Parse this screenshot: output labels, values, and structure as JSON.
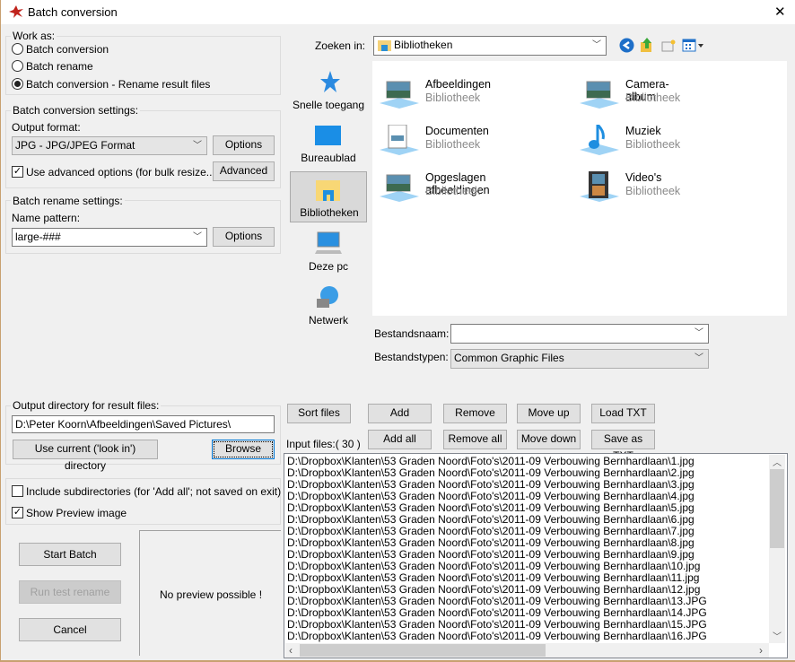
{
  "window": {
    "title": "Batch conversion",
    "close": "✕"
  },
  "work_as": {
    "label": "Work as:",
    "options": [
      {
        "label": "Batch conversion",
        "selected": false
      },
      {
        "label": "Batch rename",
        "selected": false
      },
      {
        "label": "Batch conversion - Rename result files",
        "selected": true
      }
    ]
  },
  "conversion": {
    "label": "Batch conversion settings:",
    "format_label": "Output format:",
    "format_value": "JPG - JPG/JPEG Format",
    "options_btn": "Options",
    "advanced_chk": "Use advanced options (for bulk resize...)",
    "advanced_checked": true,
    "advanced_btn": "Advanced"
  },
  "rename": {
    "label": "Batch rename settings:",
    "pattern_label": "Name pattern:",
    "pattern_value": "large-###",
    "options_btn": "Options"
  },
  "output": {
    "label": "Output directory for result files:",
    "value": "D:\\Peter Koorn\\Afbeeldingen\\Saved Pictures\\",
    "use_current_btn": "Use current ('look in') directory",
    "browse_btn": "Browse"
  },
  "misc": {
    "include_sub": "Include subdirectories (for 'Add all'; not saved on exit)",
    "include_sub_checked": false,
    "show_preview": "Show Preview image",
    "show_preview_checked": true
  },
  "actions": {
    "start": "Start Batch",
    "test": "Run test rename",
    "cancel": "Cancel"
  },
  "preview": {
    "text": "No preview possible !"
  },
  "browser": {
    "look_in_label": "Zoeken in:",
    "look_in_value": "Bibliotheken",
    "places": [
      "Snelle toegang",
      "Bureaublad",
      "Bibliotheken",
      "Deze pc",
      "Netwerk"
    ],
    "selected_place": "Bibliotheken",
    "items": [
      {
        "name": "Afbeeldingen",
        "type": "Bibliotheek"
      },
      {
        "name": "Camera-album",
        "type": "Bibliotheek"
      },
      {
        "name": "Documenten",
        "type": "Bibliotheek"
      },
      {
        "name": "Muziek",
        "type": "Bibliotheek"
      },
      {
        "name": "Opgeslagen afbeeldingen",
        "type": "Bibliotheek"
      },
      {
        "name": "Video's",
        "type": "Bibliotheek"
      }
    ],
    "filename_label": "Bestandsnaam:",
    "filename_value": "",
    "filetype_label": "Bestandstypen:",
    "filetype_value": "Common Graphic Files"
  },
  "files": {
    "buttons": {
      "sort": "Sort files",
      "add": "Add",
      "remove": "Remove",
      "move_up": "Move up",
      "load": "Load TXT",
      "add_all": "Add all",
      "remove_all": "Remove all",
      "move_down": "Move down",
      "save": "Save as TXT"
    },
    "count_label": "Input files:( 30 )",
    "list": [
      "D:\\Dropbox\\Klanten\\53 Graden Noord\\Foto's\\2011-09 Verbouwing Bernhardlaan\\1.jpg",
      "D:\\Dropbox\\Klanten\\53 Graden Noord\\Foto's\\2011-09 Verbouwing Bernhardlaan\\2.jpg",
      "D:\\Dropbox\\Klanten\\53 Graden Noord\\Foto's\\2011-09 Verbouwing Bernhardlaan\\3.jpg",
      "D:\\Dropbox\\Klanten\\53 Graden Noord\\Foto's\\2011-09 Verbouwing Bernhardlaan\\4.jpg",
      "D:\\Dropbox\\Klanten\\53 Graden Noord\\Foto's\\2011-09 Verbouwing Bernhardlaan\\5.jpg",
      "D:\\Dropbox\\Klanten\\53 Graden Noord\\Foto's\\2011-09 Verbouwing Bernhardlaan\\6.jpg",
      "D:\\Dropbox\\Klanten\\53 Graden Noord\\Foto's\\2011-09 Verbouwing Bernhardlaan\\7.jpg",
      "D:\\Dropbox\\Klanten\\53 Graden Noord\\Foto's\\2011-09 Verbouwing Bernhardlaan\\8.jpg",
      "D:\\Dropbox\\Klanten\\53 Graden Noord\\Foto's\\2011-09 Verbouwing Bernhardlaan\\9.jpg",
      "D:\\Dropbox\\Klanten\\53 Graden Noord\\Foto's\\2011-09 Verbouwing Bernhardlaan\\10.jpg",
      "D:\\Dropbox\\Klanten\\53 Graden Noord\\Foto's\\2011-09 Verbouwing Bernhardlaan\\11.jpg",
      "D:\\Dropbox\\Klanten\\53 Graden Noord\\Foto's\\2011-09 Verbouwing Bernhardlaan\\12.jpg",
      "D:\\Dropbox\\Klanten\\53 Graden Noord\\Foto's\\2011-09 Verbouwing Bernhardlaan\\13.JPG",
      "D:\\Dropbox\\Klanten\\53 Graden Noord\\Foto's\\2011-09 Verbouwing Bernhardlaan\\14.JPG",
      "D:\\Dropbox\\Klanten\\53 Graden Noord\\Foto's\\2011-09 Verbouwing Bernhardlaan\\15.JPG",
      "D:\\Dropbox\\Klanten\\53 Graden Noord\\Foto's\\2011-09 Verbouwing Bernhardlaan\\16.JPG"
    ]
  }
}
